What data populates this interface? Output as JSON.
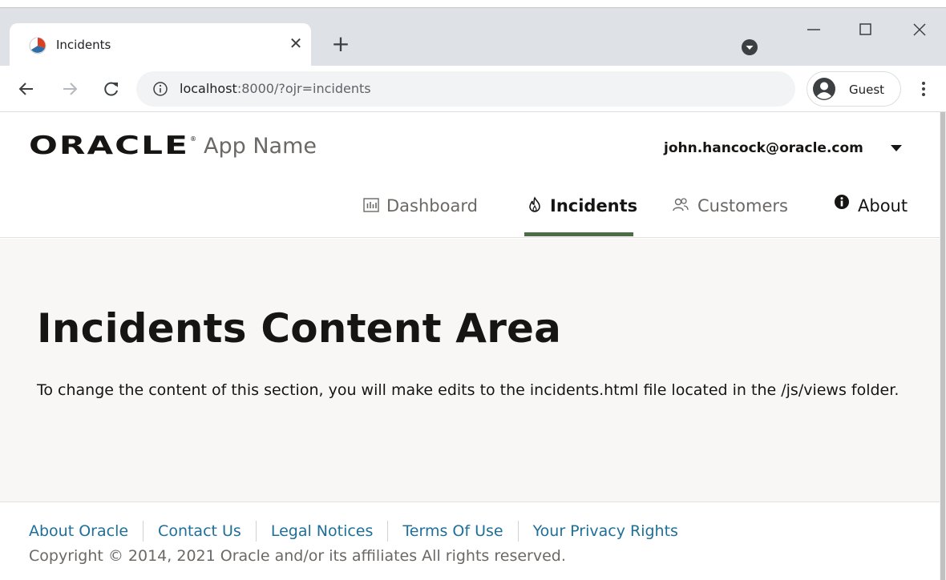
{
  "browser": {
    "tab_title": "Incidents",
    "url_host": "localhost",
    "url_rest": ":8000/?ojr=incidents",
    "profile_label": "Guest"
  },
  "header": {
    "app_name": "App Name",
    "user_email": "john.hancock@oracle.com"
  },
  "nav": {
    "items": [
      {
        "label": "Dashboard",
        "icon": "bar-chart-icon",
        "active": false
      },
      {
        "label": "Incidents",
        "icon": "fire-icon",
        "active": true
      },
      {
        "label": "Customers",
        "icon": "people-icon",
        "active": false
      },
      {
        "label": "About",
        "icon": "info-icon",
        "active": false
      }
    ]
  },
  "content": {
    "title": "Incidents Content Area",
    "text": "To change the content of this section, you will make edits to the incidents.html file located in the /js/views folder."
  },
  "footer": {
    "links": [
      "About Oracle",
      "Contact Us",
      "Legal Notices",
      "Terms Of Use",
      "Your Privacy Rights"
    ],
    "copyright": "Copyright © 2014, 2021 Oracle and/or its affiliates All rights reserved."
  },
  "colors": {
    "accent_underline": "#4e6c48",
    "link": "#1e6f99",
    "content_bg": "#f8f7f5"
  }
}
